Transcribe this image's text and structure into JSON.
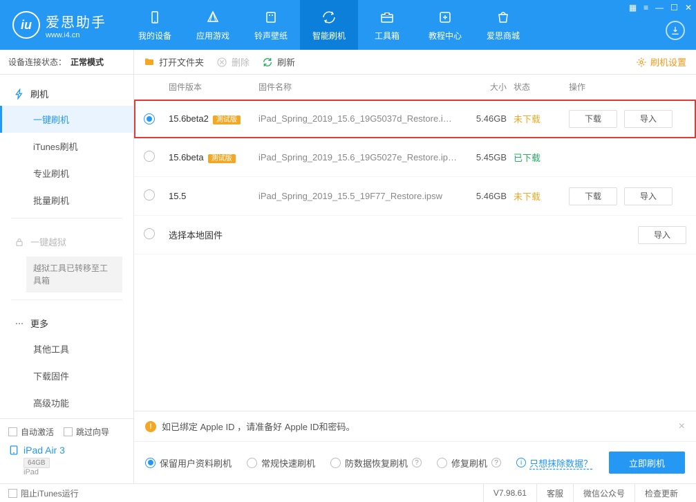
{
  "brand": {
    "name": "爱思助手",
    "url": "www.i4.cn",
    "glyph": "iu"
  },
  "nav": {
    "items": [
      {
        "label": "我的设备"
      },
      {
        "label": "应用游戏"
      },
      {
        "label": "铃声壁纸"
      },
      {
        "label": "智能刷机"
      },
      {
        "label": "工具箱"
      },
      {
        "label": "教程中心"
      },
      {
        "label": "爱思商城"
      }
    ]
  },
  "conn": {
    "label": "设备连接状态：",
    "value": "正常模式"
  },
  "side": {
    "groups": [
      {
        "icon": "flash",
        "title": "刷机",
        "items": [
          "一键刷机",
          "iTunes刷机",
          "专业刷机",
          "批量刷机"
        ]
      },
      {
        "icon": "lock",
        "title": "一键越狱",
        "disabled": true,
        "note": "越狱工具已转移至工具箱"
      },
      {
        "icon": "dots",
        "title": "更多",
        "items": [
          "其他工具",
          "下载固件",
          "高级功能"
        ]
      }
    ],
    "bottom": {
      "auto_activate": "自动激活",
      "skip_guide": "跳过向导",
      "device_name": "iPad Air 3",
      "device_cap": "64GB",
      "device_type": "iPad"
    }
  },
  "toolbar": {
    "open_folder": "打开文件夹",
    "delete": "删除",
    "refresh": "刷新",
    "settings": "刷机设置"
  },
  "columns": {
    "ver": "固件版本",
    "name": "固件名称",
    "size": "大小",
    "state": "状态",
    "ops": "操作"
  },
  "rows": [
    {
      "selected": true,
      "highlight": true,
      "version": "15.6beta2",
      "beta": true,
      "tag": "測试版",
      "filename": "iPad_Spring_2019_15.6_19G5037d_Restore.i…",
      "size": "5.46GB",
      "state": "未下载",
      "state_cls": "nd",
      "download": "下载",
      "import": "导入",
      "show_ops": true
    },
    {
      "selected": false,
      "version": "15.6beta",
      "beta": true,
      "tag": "測试版",
      "filename": "iPad_Spring_2019_15.6_19G5027e_Restore.ip…",
      "size": "5.45GB",
      "state": "已下载",
      "state_cls": "dd",
      "show_ops": false
    },
    {
      "selected": false,
      "version": "15.5",
      "beta": false,
      "filename": "iPad_Spring_2019_15.5_19F77_Restore.ipsw",
      "size": "5.46GB",
      "state": "未下载",
      "state_cls": "nd",
      "download": "下载",
      "import": "导入",
      "show_ops": true
    },
    {
      "selected": false,
      "version": "选择本地固件",
      "local": true,
      "import": "导入",
      "show_ops": true,
      "only_import": true
    }
  ],
  "alert": "如已绑定 Apple ID ，请准备好 Apple ID和密码。",
  "modes": {
    "options": [
      "保留用户资料刷机",
      "常规快速刷机",
      "防数据恢复刷机",
      "修复刷机"
    ],
    "erase_link": "只想抹除数据？",
    "submit": "立即刷机"
  },
  "status": {
    "block_itunes": "阻止iTunes运行",
    "version": "V7.98.61",
    "cells": [
      "客服",
      "微信公众号",
      "检查更新"
    ]
  }
}
